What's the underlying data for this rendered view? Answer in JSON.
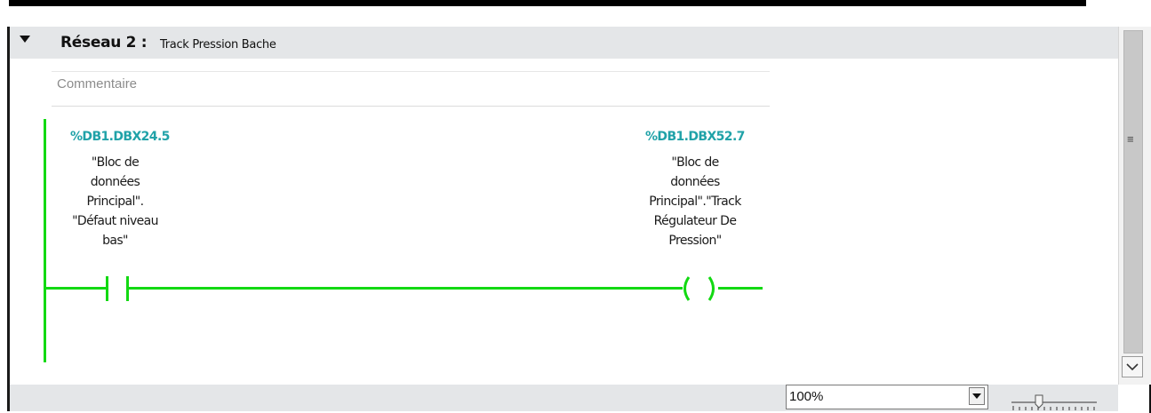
{
  "network": {
    "label": "Réseau 2 :",
    "title": "Track Pression Bache",
    "comment_placeholder": "Commentaire"
  },
  "contact": {
    "address": "%DB1.DBX24.5",
    "name": "\"Bloc de\ndonnées\nPrincipal\".\n\"Défaut niveau\nbas\""
  },
  "coil": {
    "address": "%DB1.DBX52.7",
    "name": "\"Bloc de\ndonnées\nPrincipal\".\"Track\nRégulateur De\nPression\""
  },
  "statusbar": {
    "zoom_value": "100%"
  },
  "icons": {
    "collapse": "triangle-down-icon",
    "scroll_grip": "grip-icon",
    "scroll_down": "chevron-down-icon",
    "zoom_dropdown": "triangle-down-icon",
    "zoom_slider": "slider-icon"
  },
  "colors": {
    "powered_wire": "#12d912",
    "operand_address": "#20a2a8",
    "header_bg": "#e4e6e8"
  }
}
